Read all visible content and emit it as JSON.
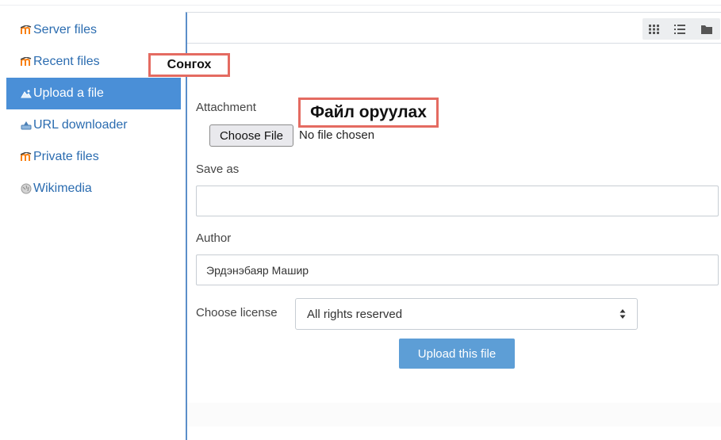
{
  "sidebar": {
    "items": [
      {
        "label": "Server files",
        "icon": "moodle-icon"
      },
      {
        "label": "Recent files",
        "icon": "moodle-icon"
      },
      {
        "label": "Upload a file",
        "icon": "upload-icon",
        "active": true
      },
      {
        "label": "URL downloader",
        "icon": "url-downloader-icon"
      },
      {
        "label": "Private files",
        "icon": "moodle-icon"
      },
      {
        "label": "Wikimedia",
        "icon": "wikimedia-icon"
      }
    ]
  },
  "toolbar": {
    "view_buttons": [
      "grid-view-icon",
      "list-view-icon",
      "folder-view-icon"
    ]
  },
  "annotations": {
    "select_note": "Сонгох",
    "upload_note": "Файл оруулах",
    "color": "#e46b61"
  },
  "form": {
    "attachment_label": "Attachment",
    "choose_file_button": "Choose File",
    "no_file_text": "No file chosen",
    "save_as_label": "Save as",
    "save_as_value": "",
    "author_label": "Author",
    "author_value": "Эрдэнэбаяр Машир",
    "license_label": "Choose license",
    "license_value": "All rights reserved",
    "upload_button": "Upload this file"
  },
  "colors": {
    "active_bg": "#4a8fd7",
    "link": "#2b6cb0",
    "button": "#5d9ed6",
    "moodle_orange": "#f98012"
  }
}
